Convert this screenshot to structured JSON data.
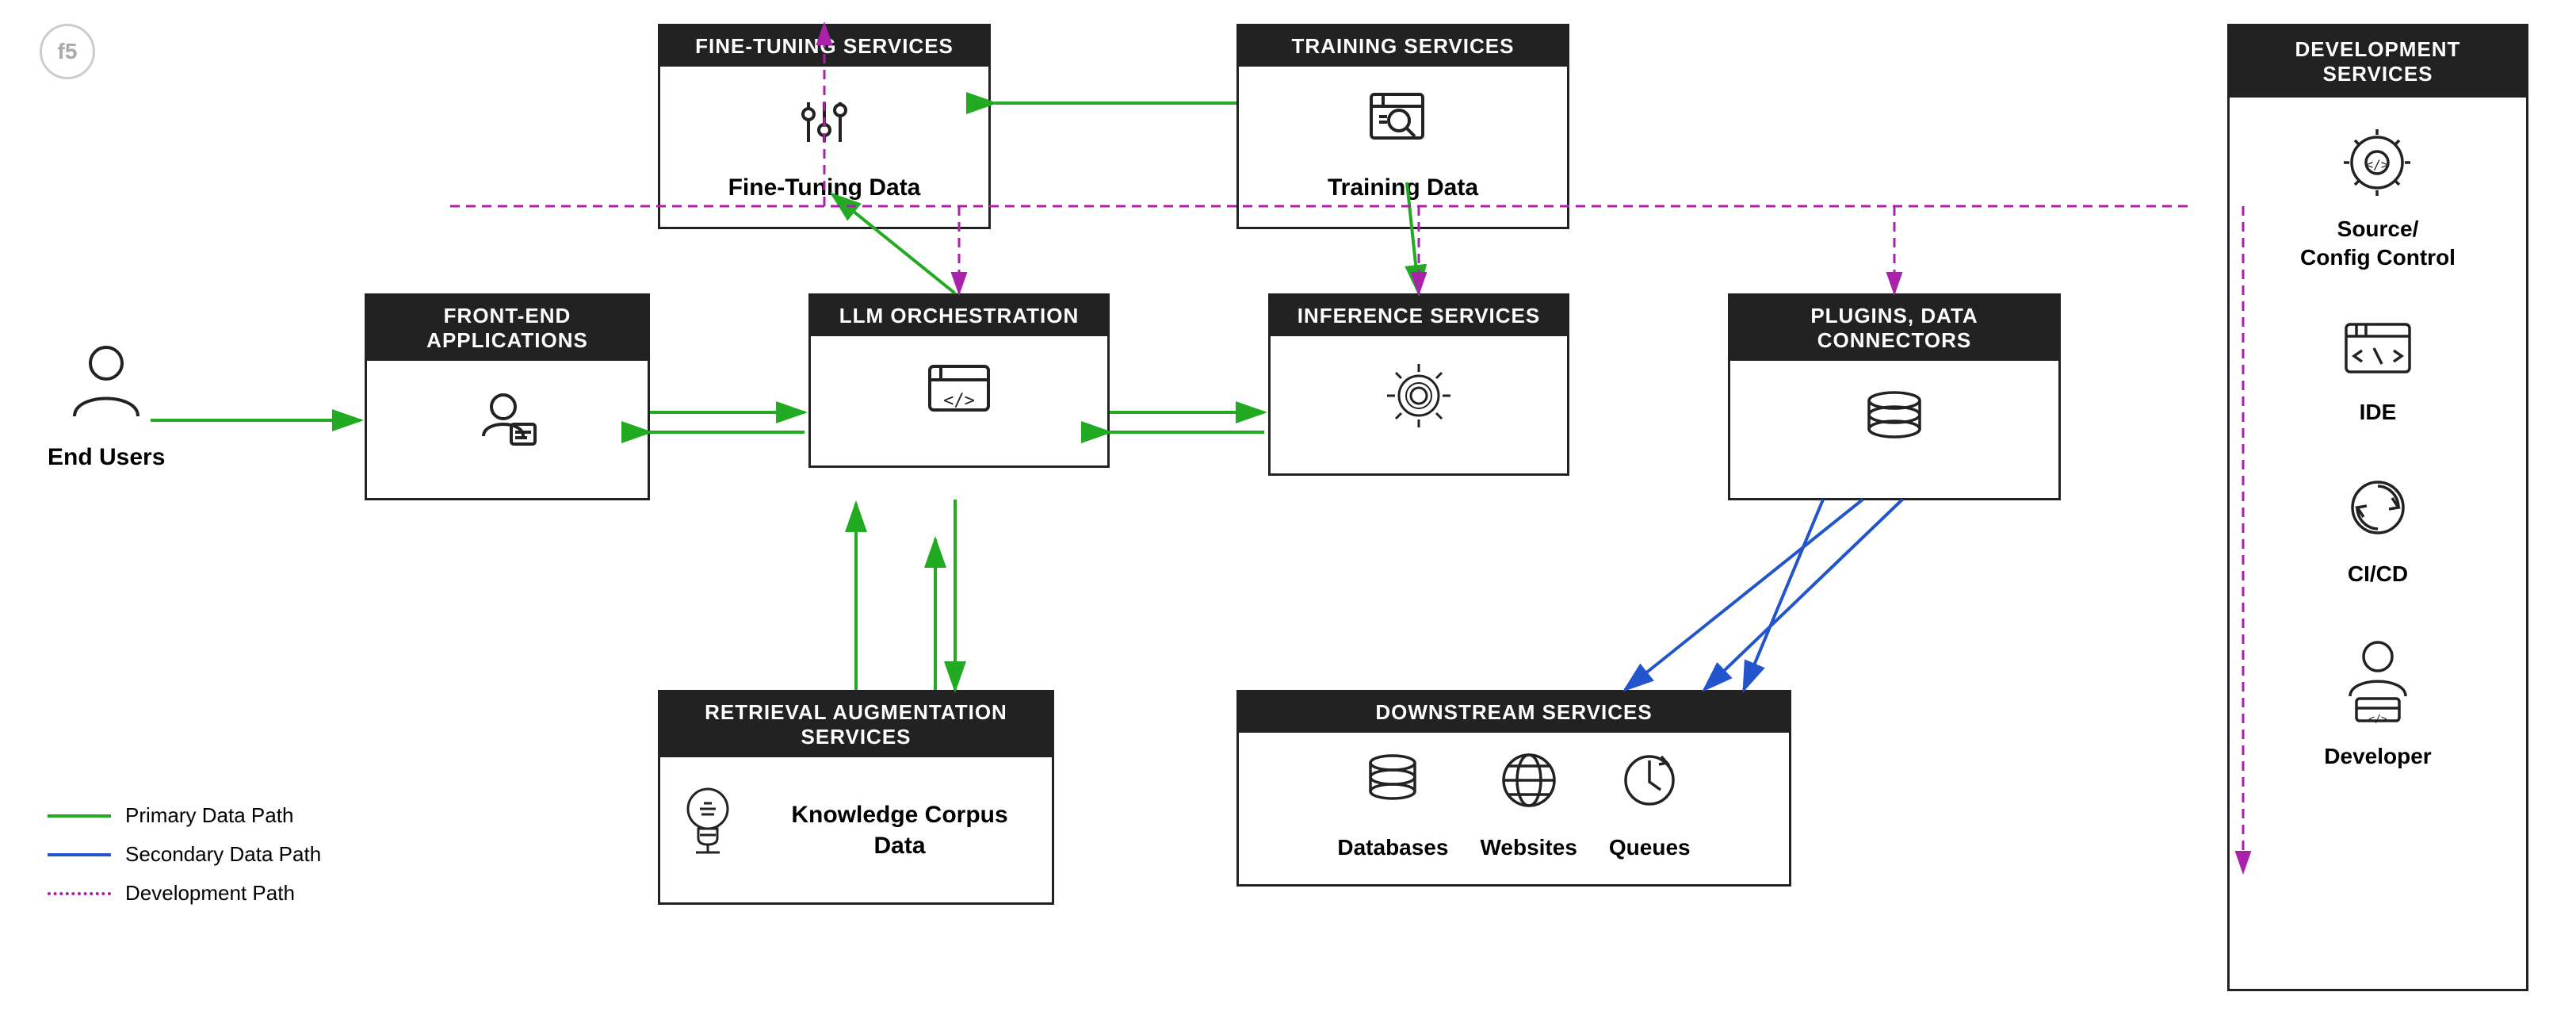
{
  "logo": {
    "text": "f5"
  },
  "services": {
    "fine_tuning": {
      "header": "FINE-TUNING SERVICES",
      "label": "Fine-Tuning Data"
    },
    "training": {
      "header": "TRAINING SERVICES",
      "label": "Training Data"
    },
    "frontend": {
      "header": "FRONT-END APPLICATIONS"
    },
    "llm": {
      "header": "LLM ORCHESTRATION"
    },
    "inference": {
      "header": "INFERENCE SERVICES"
    },
    "plugins": {
      "header": "PLUGINS, DATA CONNECTORS"
    },
    "retrieval": {
      "header": "RETRIEVAL AUGMENTATION SERVICES",
      "label": "Knowledge Corpus Data"
    },
    "downstream": {
      "header": "DOWNSTREAM SERVICES",
      "items": [
        {
          "label": "Databases"
        },
        {
          "label": "Websites"
        },
        {
          "label": "Queues"
        }
      ]
    },
    "development": {
      "header": "DEVELOPMENT SERVICES",
      "items": [
        {
          "label": "Source/ Config Control"
        },
        {
          "label": "IDE"
        },
        {
          "label": "CI/CD"
        },
        {
          "label": "Developer"
        }
      ]
    }
  },
  "end_users": {
    "label": "End Users"
  },
  "legend": {
    "items": [
      {
        "label": "Primary Data Path",
        "type": "green"
      },
      {
        "label": "Secondary Data Path",
        "type": "blue"
      },
      {
        "label": "Development Path",
        "type": "dotted-purple"
      }
    ]
  }
}
